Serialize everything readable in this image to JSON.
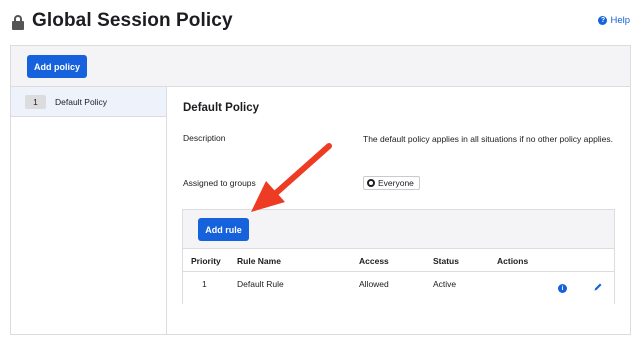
{
  "header": {
    "title": "Global Session Policy",
    "help_label": "Help",
    "help_icon_glyph": "?"
  },
  "toolbar": {
    "add_policy_label": "Add policy"
  },
  "sidebar": {
    "items": [
      {
        "number": "1",
        "label": "Default Policy",
        "selected": true
      }
    ]
  },
  "policy": {
    "title": "Default Policy",
    "description_label": "Description",
    "description_value": "The default policy applies in all situations if no other policy applies.",
    "groups_label": "Assigned to groups",
    "groups": [
      "Everyone"
    ]
  },
  "rules": {
    "add_rule_label": "Add rule",
    "columns": [
      "Priority",
      "Rule Name",
      "Access",
      "Status",
      "Actions"
    ],
    "rows": [
      {
        "priority": "1",
        "name": "Default Rule",
        "access": "Allowed",
        "status": "Active"
      }
    ],
    "info_icon_glyph": "i"
  },
  "colors": {
    "primary": "#1662dd",
    "annotation_arrow": "#ee3b24"
  }
}
